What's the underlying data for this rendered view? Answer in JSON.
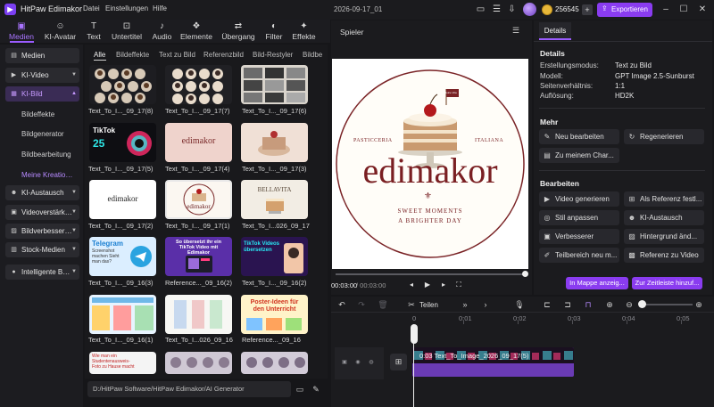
{
  "app": {
    "name": "HitPaw Edimakor",
    "menus": [
      "Datei",
      "Einstellungen",
      "Hilfe"
    ],
    "project_title": "2026-09-17_01",
    "credits": "256545",
    "export_label": "Exportieren"
  },
  "toolbar": {
    "tools": [
      "Medien",
      "KI-Avatar",
      "Text",
      "Untertitel",
      "Audio",
      "Elemente",
      "Übergang",
      "Filter",
      "Effekte"
    ],
    "active": "Medien"
  },
  "sidebar": {
    "items": [
      {
        "label": "Medien"
      },
      {
        "label": "KI-Video"
      },
      {
        "label": "KI-Bild"
      },
      {
        "label": "KI-Austausch"
      },
      {
        "label": "Videoverstärk…"
      },
      {
        "label": "Bildverbesser…"
      },
      {
        "label": "Stock-Medien"
      },
      {
        "label": "Intelligente B…"
      }
    ],
    "sub_items": [
      "Bildeffekte",
      "Bildgenerator",
      "Bildbearbeitung",
      "Meine Kreatio…"
    ]
  },
  "media": {
    "filter_tabs": [
      "Alle",
      "Bildeffekte",
      "Text zu Bild",
      "Referenzbild",
      "Bild-Restyler",
      "Bildbe"
    ],
    "items": [
      {
        "caption": "Text_To_I..._09_17(8)"
      },
      {
        "caption": "Text_To_I..._09_17(7)"
      },
      {
        "caption": "Text_To_I..._09_17(6)"
      },
      {
        "caption": "Text_To_I..._09_17(5)"
      },
      {
        "caption": "Text_To_I..._09_17(4)"
      },
      {
        "caption": "Text_To_I..._09_17(3)"
      },
      {
        "caption": "Text_To_I..._09_17(2)"
      },
      {
        "caption": "Text_To_I..._09_17(1)"
      },
      {
        "caption": "Text_To_I...026_09_17"
      },
      {
        "caption": "Text_To_I..._09_16(3)"
      },
      {
        "caption": "Reference..._09_16(2)"
      },
      {
        "caption": "Text_To_I..._09_16(2)"
      },
      {
        "caption": "Text_To_I..._09_16(1)"
      },
      {
        "caption": "Text_To_I...026_09_16"
      },
      {
        "caption": "Reference..._09_16"
      }
    ],
    "thumb_text": {
      "tiktok": "TikTok",
      "tiktok_big": "25",
      "logo": "edimakor",
      "bellavita": "BELLAVITA",
      "telegram": "Telegram",
      "telegram_sub": "Screenshot machen Sieht man das?",
      "tiktok_video": "So übersetzt ihr ein TikTok Video mit Edimakor",
      "tiktok_translate": "TikTok Videos übersetzen",
      "poster": "Poster-Ideen für den Unterricht",
      "student": "Wie man ein Studentenausweis-Foto zu Hause macht"
    },
    "path": "D:/HitPaw Software/HitPaw Edimakor/AI Generator"
  },
  "player": {
    "title": "Spieler",
    "current_time": "00:03:00",
    "total_time": "/ 00:03:00",
    "progress": 1.0,
    "artwork": {
      "brand": "edimakor",
      "top_left": "PASTICCERIA",
      "top_right": "ITALIANA",
      "tagline1": "SWEET MOMENTS",
      "tagline2": "A BRIGHTER DAY",
      "flag": "Dolce Vita"
    }
  },
  "details": {
    "tab": "Details",
    "heading": "Details",
    "rows": [
      {
        "key": "Erstellungsmodus:",
        "value": "Text zu Bild"
      },
      {
        "key": "Modell:",
        "value": "GPT Image 2.5-Sunburst"
      },
      {
        "key": "Seitenverhältnis:",
        "value": "1:1"
      },
      {
        "key": "Auflösung:",
        "value": "HD2K"
      }
    ],
    "more_heading": "Mehr",
    "more_buttons": [
      "Neu bearbeiten",
      "Regenerieren",
      "Zu meinem Char..."
    ],
    "edit_heading": "Bearbeiten",
    "edit_buttons": [
      "Video generieren",
      "Als Referenz festl...",
      "Stil anpassen",
      "KI-Austausch",
      "Verbesserer",
      "Hintergrund änd...",
      "Teilbereich neu m...",
      "Referenz zu Video"
    ],
    "footer_buttons": [
      "In Mappe anzeig...",
      "Zur Zeitleiste hinzuf..."
    ]
  },
  "timeline": {
    "split_label": "Teilen",
    "ruler": [
      "0",
      "0:01",
      "0:02",
      "0:03",
      "0:04",
      "0:05"
    ],
    "clip_label": "0:03 Text_To_Image_2026_09_17(5)",
    "zoom_level": 0.05
  },
  "colors": {
    "accent": "#8a3cf0",
    "bg": "#161619",
    "panel": "#1b1b1e"
  }
}
